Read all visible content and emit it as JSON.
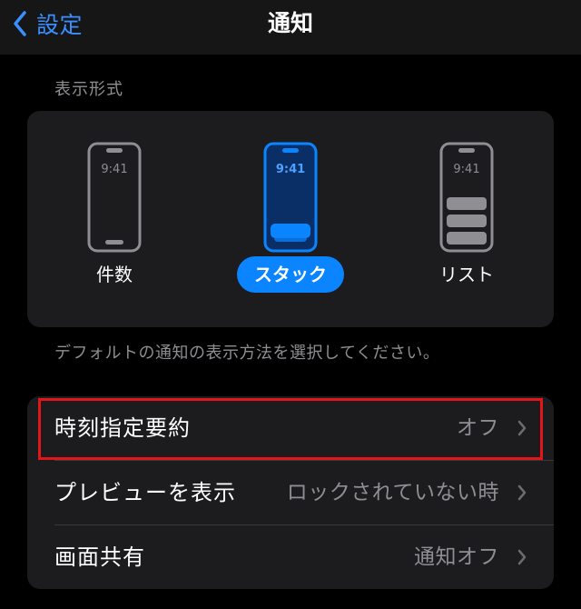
{
  "nav": {
    "back_label": "設定",
    "title": "通知"
  },
  "display_style": {
    "section_label": "表示形式",
    "phone_time": "9:41",
    "options": [
      {
        "label": "件数",
        "selected": false
      },
      {
        "label": "スタック",
        "selected": true
      },
      {
        "label": "リスト",
        "selected": false
      }
    ],
    "footer": "デフォルトの通知の表示方法を選択してください。"
  },
  "settings": {
    "rows": [
      {
        "label": "時刻指定要約",
        "value": "オフ"
      },
      {
        "label": "プレビューを表示",
        "value": "ロックされていない時"
      },
      {
        "label": "画面共有",
        "value": "通知オフ"
      }
    ]
  },
  "colors": {
    "accent": "#0a84ff",
    "highlight_border": "#e0161b"
  }
}
